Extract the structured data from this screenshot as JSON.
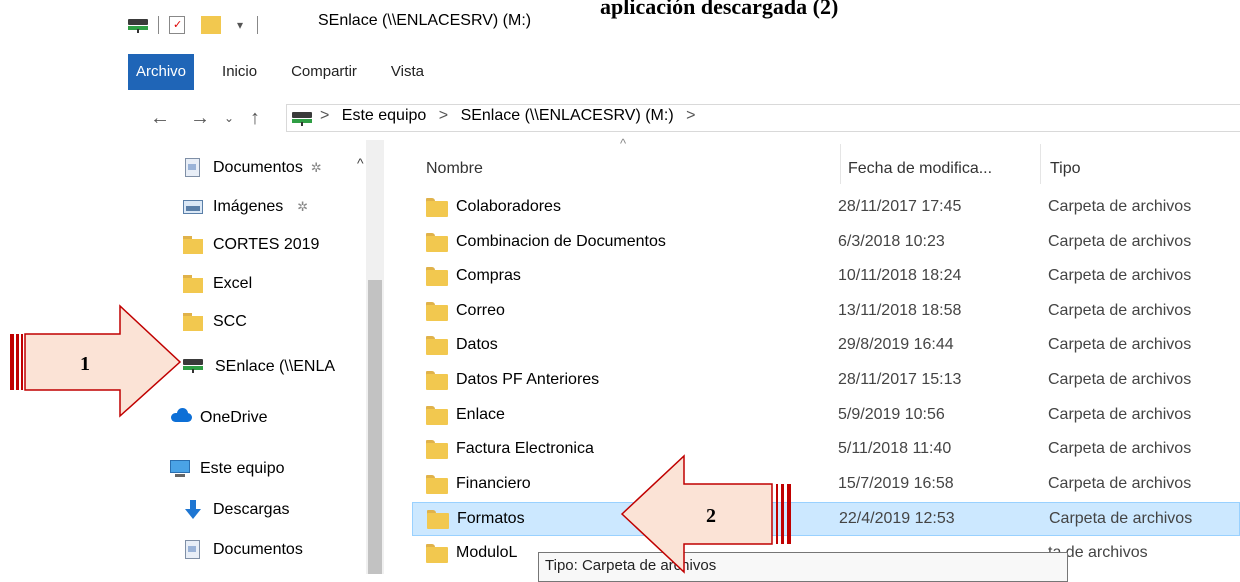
{
  "caption": "aplicación descargada (2)",
  "window": {
    "title": "SEnlace (\\\\ENLACESRV) (M:)"
  },
  "ribbon": {
    "tabs": [
      "Archivo",
      "Inicio",
      "Compartir",
      "Vista"
    ],
    "active_index": 0
  },
  "address": {
    "crumbs": [
      "Este equipo",
      "SEnlace (\\\\ENLACESRV) (M:)"
    ],
    "separator": ">"
  },
  "nav_pane": {
    "items": [
      {
        "label": "Documentos",
        "icon": "documents-icon",
        "pinned": true
      },
      {
        "label": "Imágenes",
        "icon": "pictures-icon",
        "pinned": true
      },
      {
        "label": "CORTES 2019",
        "icon": "folder-icon"
      },
      {
        "label": "Excel",
        "icon": "folder-icon"
      },
      {
        "label": "SCC",
        "icon": "folder-icon"
      },
      {
        "label": "SEnlace (\\\\ENLA",
        "icon": "network-drive-icon"
      },
      {
        "label": "OneDrive",
        "icon": "onedrive-icon"
      },
      {
        "label": "Este equipo",
        "icon": "this-pc-icon"
      },
      {
        "label": "Descargas",
        "icon": "downloads-icon"
      },
      {
        "label": "Documentos",
        "icon": "documents-icon"
      }
    ]
  },
  "file_list": {
    "headers": {
      "name": "Nombre",
      "date": "Fecha de modifica...",
      "type": "Tipo"
    },
    "rows": [
      {
        "name": "Colaboradores",
        "date": "28/11/2017 17:45",
        "type": "Carpeta de archivos"
      },
      {
        "name": "Combinacion de Documentos",
        "date": "6/3/2018 10:23",
        "type": "Carpeta de archivos"
      },
      {
        "name": "Compras",
        "date": "10/11/2018 18:24",
        "type": "Carpeta de archivos"
      },
      {
        "name": "Correo",
        "date": "13/11/2018 18:58",
        "type": "Carpeta de archivos"
      },
      {
        "name": "Datos",
        "date": "29/8/2019 16:44",
        "type": "Carpeta de archivos"
      },
      {
        "name": "Datos PF Anteriores",
        "date": "28/11/2017 15:13",
        "type": "Carpeta de archivos"
      },
      {
        "name": "Enlace",
        "date": "5/9/2019 10:56",
        "type": "Carpeta de archivos"
      },
      {
        "name": "Factura Electronica",
        "date": "5/11/2018 11:40",
        "type": "Carpeta de archivos"
      },
      {
        "name": "Financiero",
        "date": "15/7/2019 16:58",
        "type": "Carpeta de archivos"
      },
      {
        "name": "Formatos",
        "date": "22/4/2019 12:53",
        "type": "Carpeta de archivos",
        "selected": true
      },
      {
        "name": "ModuloL",
        "date": "",
        "type": "ta de archivos"
      }
    ]
  },
  "tooltip": "Tipo: Carpeta de archivos",
  "callouts": [
    {
      "number": "1",
      "direction": "right",
      "color": "#fbe3d6",
      "stroke": "#c00000"
    },
    {
      "number": "2",
      "direction": "left",
      "color": "#fbe3d6",
      "stroke": "#c00000"
    }
  ]
}
